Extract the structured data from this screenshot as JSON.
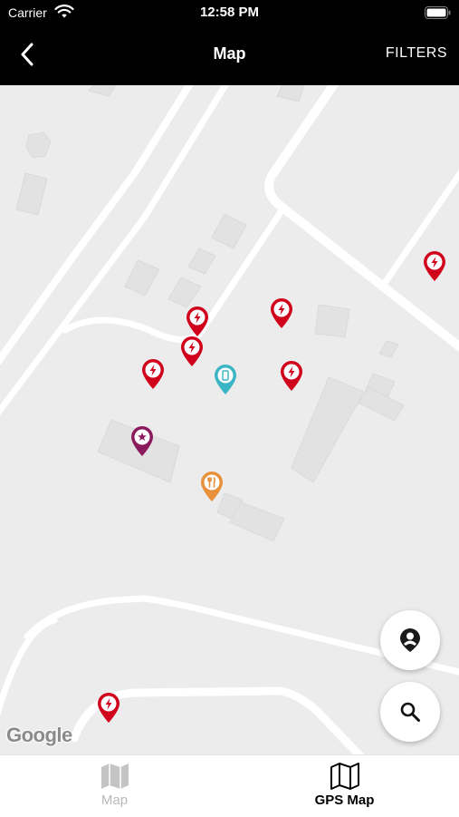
{
  "status_bar": {
    "carrier": "Carrier",
    "time": "12:58 PM"
  },
  "nav": {
    "title": "Map",
    "filters_label": "FILTERS",
    "back_icon": "chevron-left-icon"
  },
  "map": {
    "attribution": "Google",
    "pin_colors": {
      "charging": "#d0021b",
      "info": "#3ab5c3",
      "favorite": "#8b1a5c",
      "restaurant": "#e8903a"
    },
    "pins": [
      {
        "type": "charging",
        "icon": "lightning-icon"
      },
      {
        "type": "charging",
        "icon": "lightning-icon"
      },
      {
        "type": "charging",
        "icon": "lightning-icon"
      },
      {
        "type": "charging",
        "icon": "lightning-icon"
      },
      {
        "type": "charging",
        "icon": "lightning-icon"
      },
      {
        "type": "charging",
        "icon": "lightning-icon"
      },
      {
        "type": "charging",
        "icon": "lightning-icon"
      },
      {
        "type": "info",
        "icon": "phone-icon"
      },
      {
        "type": "favorite",
        "icon": "star-icon"
      },
      {
        "type": "restaurant",
        "icon": "fork-knife-icon"
      }
    ]
  },
  "fabs": {
    "profile_icon": "user-location-icon",
    "search_icon": "search-icon"
  },
  "tabbar": {
    "tabs": [
      {
        "label": "Map",
        "icon": "map-icon",
        "active": false
      },
      {
        "label": "GPS Map",
        "icon": "map-outline-icon",
        "active": true
      }
    ]
  }
}
